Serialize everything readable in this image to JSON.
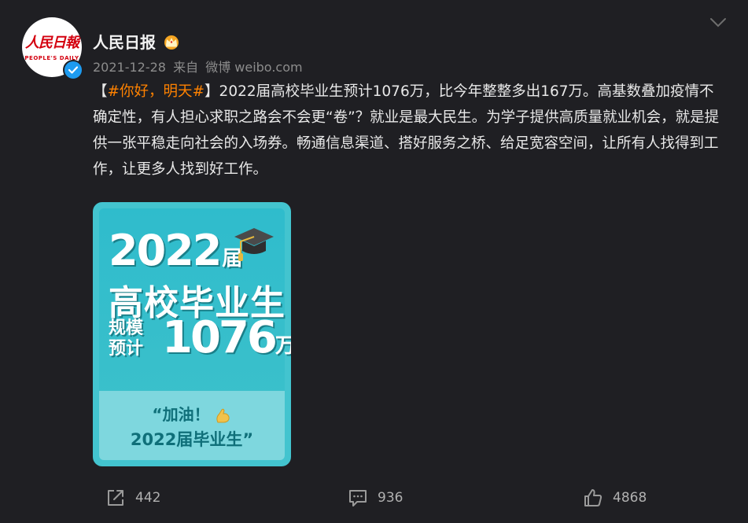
{
  "post": {
    "author": {
      "name": "人民日报",
      "avatar_text": "人民日報",
      "avatar_subtext": "PEOPLE'S DAILY"
    },
    "date": "2021-12-28",
    "source_prefix": "来自",
    "source": "微博 weibo.com",
    "text": {
      "bracket_open": "【",
      "hashtag": "#你好，明天#",
      "bracket_close": "】",
      "body": "2022届高校毕业生预计1076万，比今年整整多出167万。高基数叠加疫情不确定性，有人担心求职之路会不会更“卷”？就业是最大民生。为学子提供高质量就业机会，就是提供一张平稳走向社会的入场券。畅通信息渠道、搭好服务之桥、给足宽容空间，让所有人找得到工作，让更多人找到好工作。"
    },
    "image": {
      "year": "2022",
      "year_suffix": "届",
      "line2": "高校毕业生",
      "line3a": "规模",
      "line3b": "预计",
      "number": "1076",
      "unit": "万",
      "cheer1": "“加油！",
      "cheer2": "2022届毕业生”"
    },
    "stats": {
      "reposts": "442",
      "comments": "936",
      "likes": "4868"
    }
  },
  "colors": {
    "background": "#1f1f23",
    "hashtag": "#ff8200",
    "verified": "#1d9bf0",
    "image_bg": "#43c4cf"
  }
}
